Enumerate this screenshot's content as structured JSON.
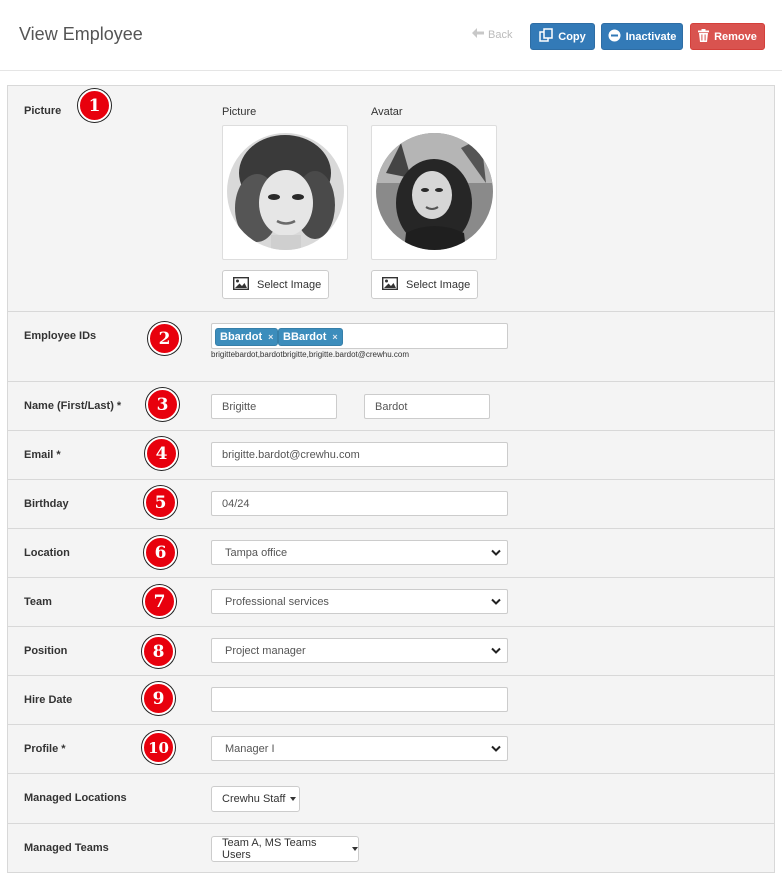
{
  "header": {
    "title": "View Employee",
    "back_label": "Back",
    "copy_label": "Copy",
    "inactivate_label": "Inactivate",
    "remove_label": "Remove"
  },
  "picture_row": {
    "label": "Picture",
    "picture_title": "Picture",
    "avatar_title": "Avatar",
    "select_image_label": "Select Image",
    "avatar_select_image_label": "Select Image"
  },
  "employee_ids": {
    "label": "Employee IDs",
    "tags": [
      "Bbardot",
      "BBardot"
    ],
    "tag_remove": "×",
    "helper": "brigittebardot,bardotbrigitte,brigitte.bardot@crewhu.com"
  },
  "name": {
    "label": "Name (First/Last) *",
    "first": "Brigitte",
    "last": "Bardot"
  },
  "email": {
    "label": "Email *",
    "value": "brigitte.bardot@crewhu.com"
  },
  "birthday": {
    "label": "Birthday",
    "value": "04/24"
  },
  "location": {
    "label": "Location",
    "value": "Tampa office"
  },
  "team": {
    "label": "Team",
    "value": "Professional services"
  },
  "position": {
    "label": "Position",
    "value": "Project manager"
  },
  "hire_date": {
    "label": "Hire Date",
    "value": ""
  },
  "profile": {
    "label": "Profile *",
    "value": "Manager I"
  },
  "managed_locations": {
    "label": "Managed Locations",
    "value": "Crewhu Staff"
  },
  "managed_teams": {
    "label": "Managed Teams",
    "value": "Team A, MS Teams Users"
  },
  "badges": [
    "1",
    "2",
    "3",
    "4",
    "5",
    "6",
    "7",
    "8",
    "9",
    "10"
  ],
  "colors": {
    "primary": "#337ab7",
    "danger": "#d9534f",
    "badge": "#e8000d",
    "tag": "#3c8dbc",
    "panel_bg": "#f4f4f4"
  },
  "icons": [
    "arrow-left-icon",
    "copy-icon",
    "minus-circle-icon",
    "trash-icon",
    "image-icon",
    "chevron-down-icon",
    "caret-down-icon"
  ]
}
